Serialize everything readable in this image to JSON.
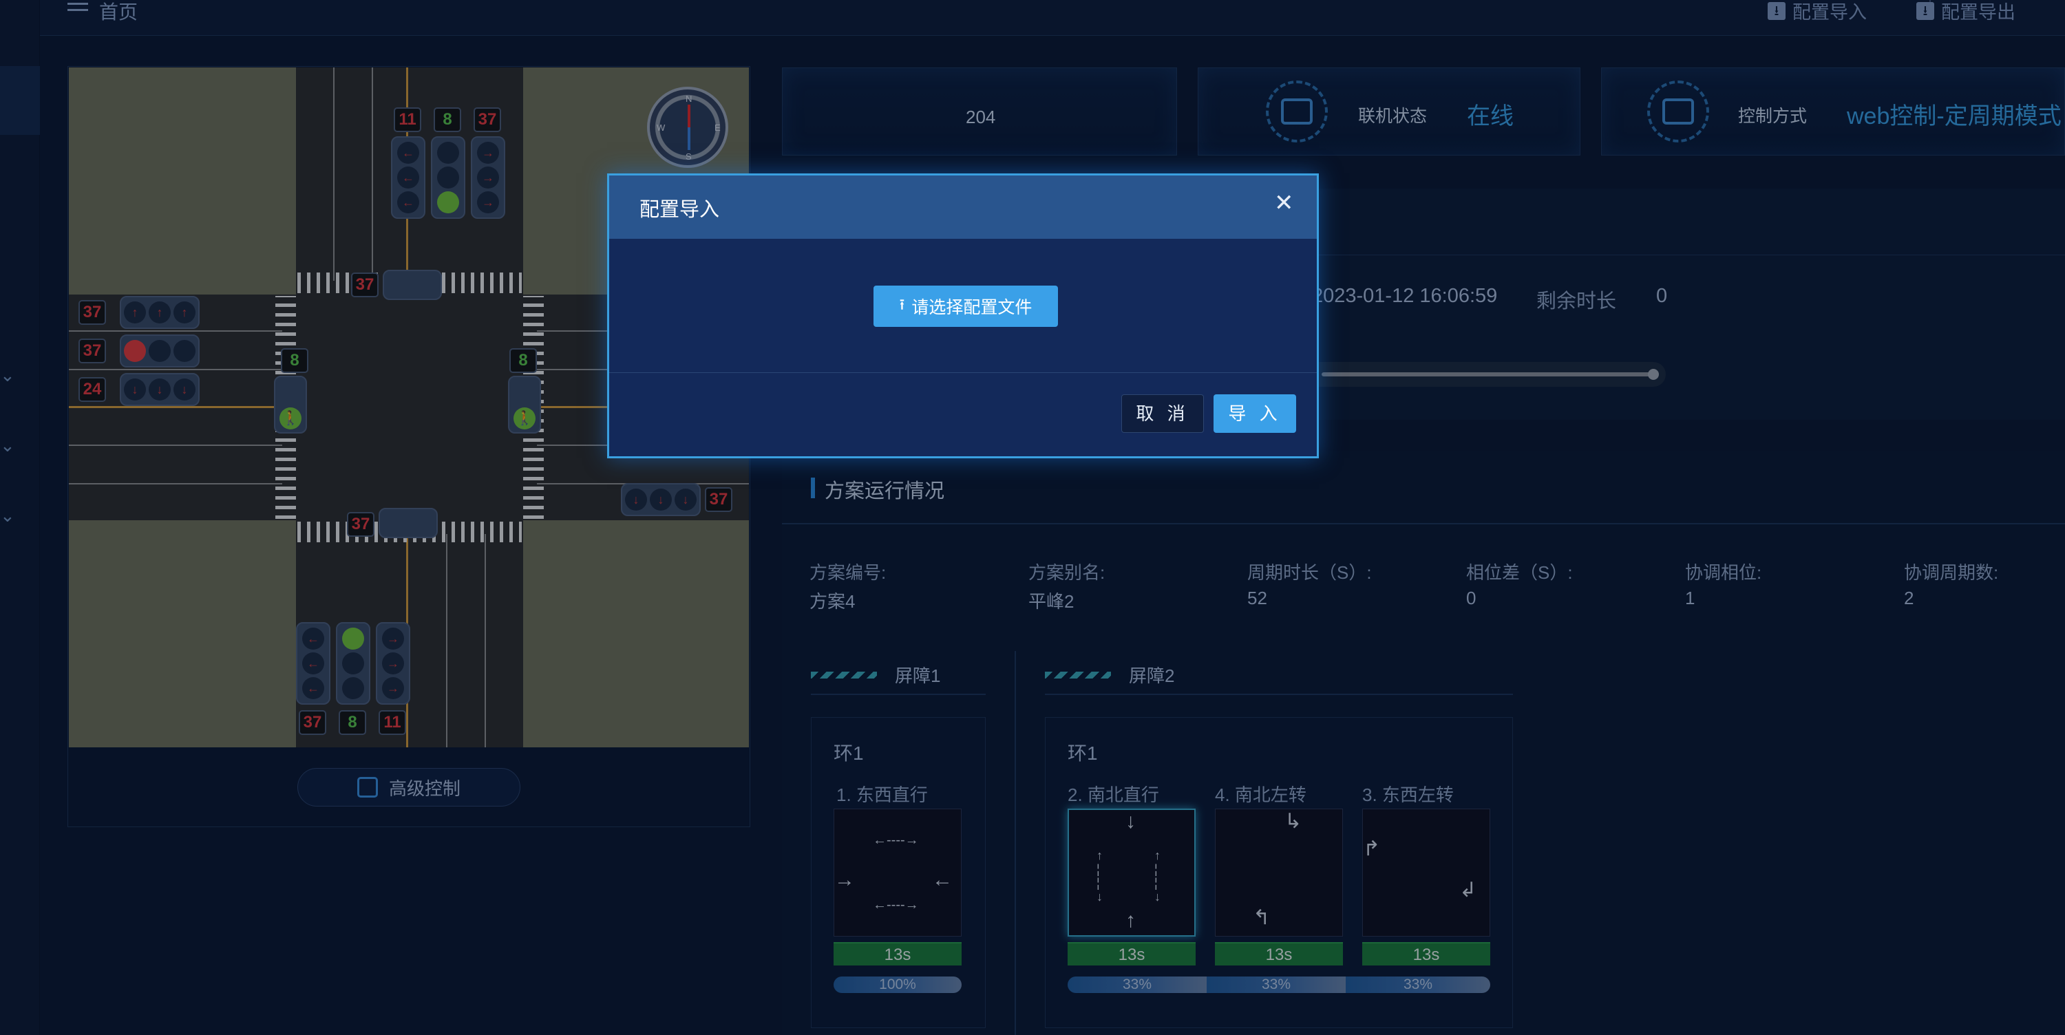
{
  "topbar": {
    "home": "首页",
    "import_btn": "配置导入",
    "export_btn": "配置导出"
  },
  "map": {
    "counters": {
      "north": [
        "11",
        "8",
        "37"
      ],
      "north_ped": "37",
      "west": [
        "37",
        "37",
        "24"
      ],
      "west_ped": "8",
      "east_ped": "8",
      "east": [
        "37",
        "37"
      ],
      "south_ped": "37",
      "south": [
        "37",
        "8",
        "11"
      ]
    },
    "compass": {
      "n": "N",
      "s": "S",
      "e": "E",
      "w": "W"
    },
    "advanced_btn": "高级控制"
  },
  "status": {
    "intersection_id": "204",
    "online_label": "联机状态",
    "online_value": "在线",
    "control_label": "控制方式",
    "control_value": "web控制-定周期模式"
  },
  "time": {
    "datetime": "2023-01-12 16:06:59",
    "remaining_label": "剩余时长",
    "remaining_value": "0"
  },
  "plan": {
    "section_title": "方案运行情况",
    "fields": [
      {
        "label": "方案编号:",
        "value": "方案4"
      },
      {
        "label": "方案别名:",
        "value": "平峰2"
      },
      {
        "label": "周期时长（S）:",
        "value": "52"
      },
      {
        "label": "相位差（S）:",
        "value": "0"
      },
      {
        "label": "协调相位:",
        "value": "1"
      },
      {
        "label": "协调周期数:",
        "value": "2"
      }
    ],
    "barriers": [
      {
        "name": "屏障1",
        "ring": "环1",
        "phases": [
          {
            "name": "1. 东西直行",
            "time": "13s",
            "pct": "100%"
          }
        ]
      },
      {
        "name": "屏障2",
        "ring": "环1",
        "phases": [
          {
            "name": "2. 南北直行",
            "time": "13s",
            "pct": "33%"
          },
          {
            "name": "4. 南北左转",
            "time": "13s",
            "pct": "33%"
          },
          {
            "name": "3. 东西左转",
            "time": "13s",
            "pct": "33%"
          }
        ]
      }
    ]
  },
  "modal": {
    "title": "配置导入",
    "upload_btn": "请选择配置文件",
    "cancel": "取 消",
    "confirm": "导 入"
  },
  "colors": {
    "accent": "#3aa0e8",
    "green_bar": "#1c7a3a",
    "background": "#0b1830"
  }
}
